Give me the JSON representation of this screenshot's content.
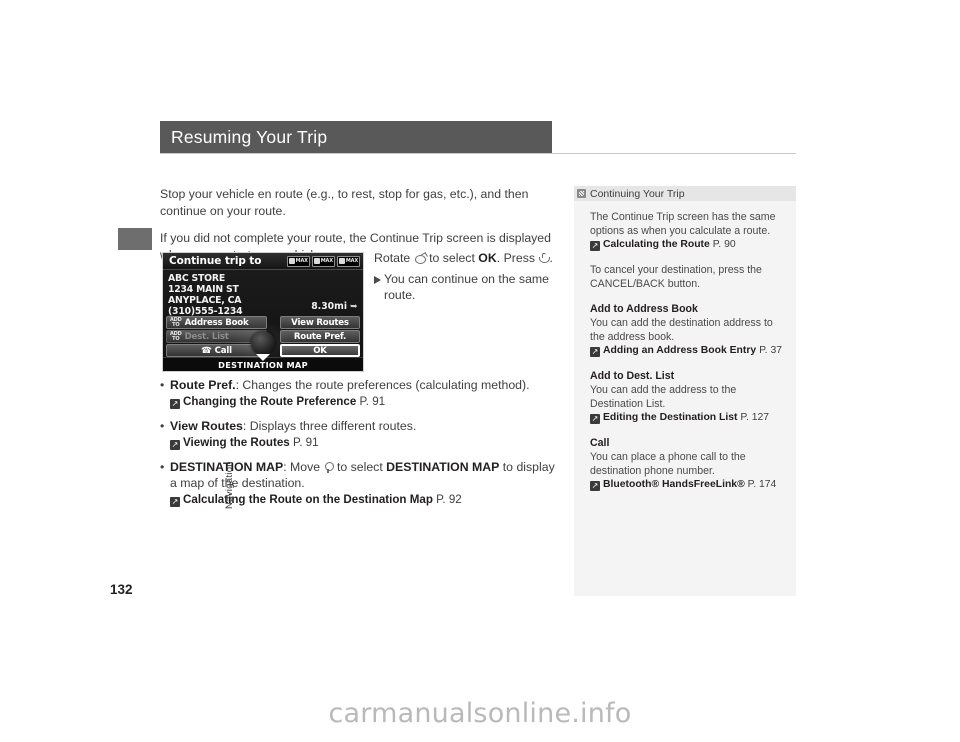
{
  "page": {
    "title": "Resuming Your Trip",
    "number": "132",
    "section_tab": "Navigation",
    "watermark": "carmanualsonline.info"
  },
  "main": {
    "paragraphs": [
      "Stop your vehicle en route (e.g., to rest, stop for gas, etc.), and then continue on your route.",
      "If you did not complete your route, the Continue Trip screen is displayed when you restart your vehicle."
    ],
    "instruction": {
      "lead": "Rotate",
      "mid": "to select",
      "target": "OK",
      "press": ". Press",
      "end": ".",
      "result": "You can continue on the same route."
    },
    "bullets": [
      {
        "term": "Route Pref.",
        "desc": ": Changes the route preferences (calculating method).",
        "ref_name": "Changing the Route Preference",
        "ref_page": "P. 91"
      },
      {
        "term": "View Routes",
        "desc": ": Displays three different routes.",
        "ref_name": "Viewing the Routes",
        "ref_page": "P. 91"
      },
      {
        "term": "DESTINATION MAP",
        "desc_a": ": Move",
        "desc_b": "to select",
        "desc_c": "DESTINATION MAP",
        "desc_d": "to display a map of the destination.",
        "ref_name": "Calculating the Route on the Destination Map",
        "ref_page": "P. 92"
      }
    ]
  },
  "nav_screen": {
    "header_title": "Continue trip to",
    "max_badges": [
      "MAX",
      "MAX",
      "MAX"
    ],
    "address": [
      "ABC STORE",
      "1234 MAIN ST",
      "ANYPLACE, CA",
      "(310)555-1234"
    ],
    "distance": "8.30mi",
    "buttons": {
      "address_book": "Address Book",
      "address_book_badge": "ADD TO",
      "dest_list": "Dest. List",
      "dest_list_badge": "ADD TO",
      "call": "Call",
      "view_routes": "View Routes",
      "route_pref": "Route Pref.",
      "ok": "OK"
    },
    "footer": "DESTINATION MAP"
  },
  "side_panel": {
    "header": "Continuing Your Trip",
    "blocks": [
      {
        "heading": "",
        "text": "The Continue Trip screen has the same options as when you calculate a route.",
        "ref_name": "Calculating the Route",
        "ref_page": "P. 90"
      },
      {
        "heading": "",
        "text": "To cancel your destination, press the CANCEL/BACK button.",
        "ref_name": "",
        "ref_page": ""
      },
      {
        "heading": "Add to Address Book",
        "text": "You can add the destination address to the address book.",
        "ref_name": "Adding an Address Book Entry",
        "ref_page": "P. 37"
      },
      {
        "heading": "Add to Dest. List",
        "text": "You can add the address to the Destination List.",
        "ref_name": "Editing the Destination List",
        "ref_page": "P. 127"
      },
      {
        "heading": "Call",
        "text": "You can place a phone call to the destination phone number.",
        "ref_name": "Bluetooth® HandsFreeLink®",
        "ref_page": "P. 174"
      }
    ]
  },
  "colors": {
    "title_band": "#595959",
    "side_panel_bg": "#f4f4f4",
    "side_head_bg": "#e6e6e6",
    "text": "#3f3f3f",
    "watermark": "#b9b9b9"
  }
}
